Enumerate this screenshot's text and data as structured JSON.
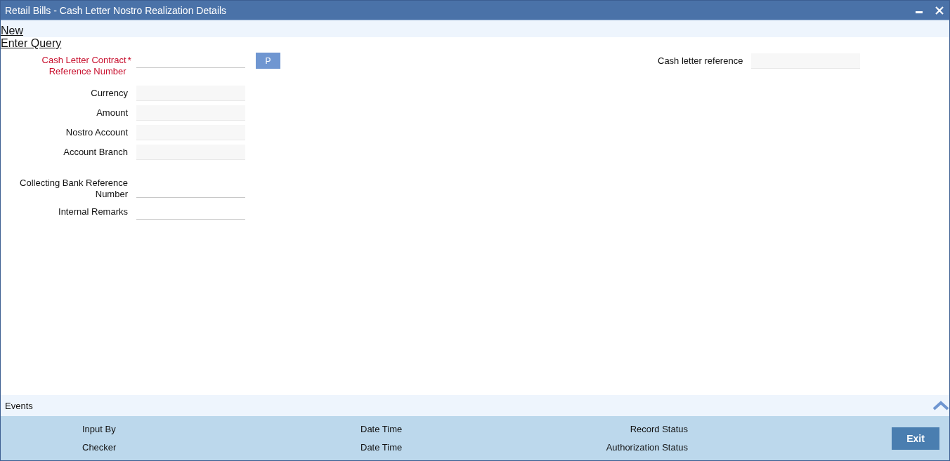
{
  "window": {
    "title": "Retail Bills - Cash Letter Nostro Realization Details"
  },
  "toolbar": [
    "New",
    "Enter Query"
  ],
  "form_groups": [
    [
      {
        "label": "Cash Letter Contract Reference Number",
        "required": true,
        "required_mark": "*",
        "kind": "underline",
        "button": "P"
      }
    ],
    [
      {
        "label": "Currency",
        "required": false,
        "kind": "filled"
      },
      {
        "label": "Amount",
        "required": false,
        "kind": "filled"
      },
      {
        "label": "Nostro Account",
        "required": false,
        "kind": "filled"
      },
      {
        "label": "Account Branch",
        "required": false,
        "kind": "filled"
      }
    ],
    [
      {
        "label": "Collecting Bank Reference Number",
        "required": false,
        "kind": "underline"
      },
      {
        "label": "Internal Remarks",
        "required": false,
        "kind": "underline"
      }
    ]
  ],
  "right_field": {
    "label": "Cash letter reference",
    "kind": "filled"
  },
  "events_bar": {
    "label": "Events"
  },
  "footer": {
    "columns": [
      [
        "Input By",
        "Checker"
      ],
      [
        "Date Time",
        "Date Time"
      ],
      [
        "Record Status",
        "Authorization Status"
      ]
    ],
    "exit_button": "Exit"
  }
}
